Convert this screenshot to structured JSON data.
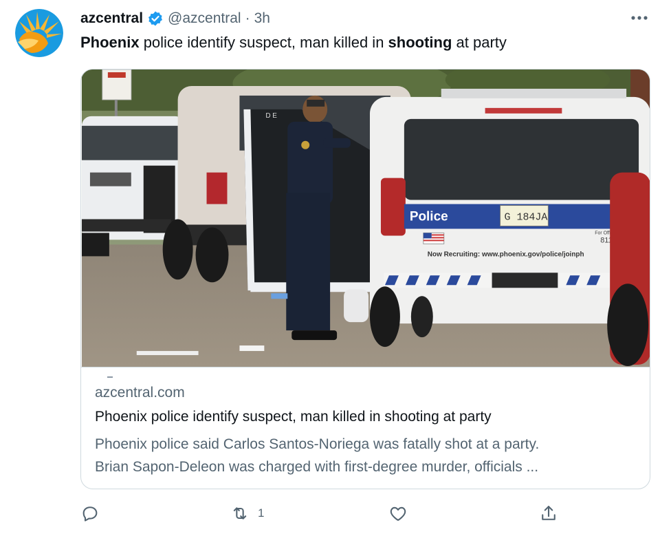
{
  "account": {
    "name": "azcentral",
    "handle": "@azcentral",
    "separator": "·",
    "time": "3h",
    "brand_color": "#1d9bf0",
    "avatar_icon": "sun-logo-icon"
  },
  "tweet": {
    "bold_1": "Phoenix",
    "text_1": " police identify suspect, man killed in ",
    "bold_2": "shooting",
    "text_2": " at party"
  },
  "card": {
    "image": {
      "description_icon": "police-scene-photo",
      "vehicle_text": "Police",
      "plate": "G 184JA",
      "recruit_text": "Now Recruiting: www.phoenix.gov/police/joinph",
      "door_text": "For Offici",
      "unit_number": "811",
      "van_text": "D E"
    },
    "domain": "azcentral.com",
    "title": "Phoenix police identify suspect, man killed in shooting at party",
    "desc_line_1": "Phoenix police said Carlos Santos-Noriega was fatally shot at a party.",
    "desc_line_2": "Brian Sapon-Deleon was charged with first-degree murder, officials ..."
  },
  "actions": {
    "reply_icon": "reply-icon",
    "retweet_icon": "retweet-icon",
    "retweet_count": "1",
    "like_icon": "heart-icon",
    "share_icon": "share-icon"
  },
  "colors": {
    "text_primary": "#0f1419",
    "text_secondary": "#536471",
    "border": "#cfd9de",
    "police_blue": "#2b4a9c"
  }
}
